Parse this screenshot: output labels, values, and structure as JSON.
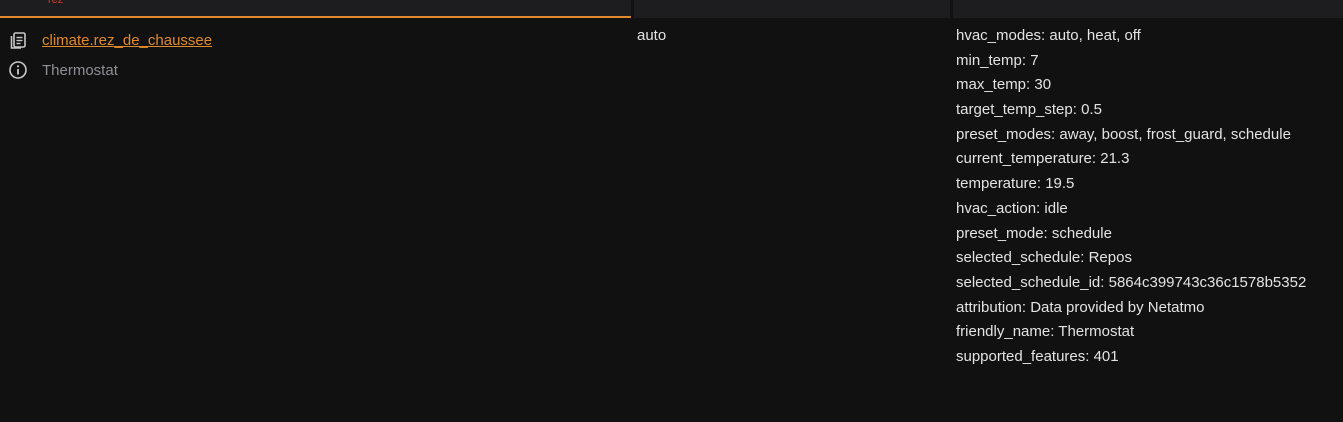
{
  "header": {
    "filter_text": "rez"
  },
  "entity": {
    "id": "climate.rez_de_chaussee",
    "friendly_name": "Thermostat",
    "state": "auto"
  },
  "attributes": [
    "hvac_modes: auto, heat, off",
    "min_temp: 7",
    "max_temp: 30",
    "target_temp_step: 0.5",
    "preset_modes: away, boost, frost_guard, schedule",
    "current_temperature: 21.3",
    "temperature: 19.5",
    "hvac_action: idle",
    "preset_mode: schedule",
    "selected_schedule: Repos",
    "selected_schedule_id: 5864c399743c36c1578b5352",
    "attribution: Data provided by Netatmo",
    "friendly_name: Thermostat",
    "supported_features: 401"
  ],
  "colors": {
    "accent": "#e08a2c",
    "background": "#111111",
    "header": "#1d1d1f",
    "text": "#e3e3e3",
    "muted": "#8f8f96"
  },
  "icons": {
    "copy": "clipboard-copy-icon",
    "info": "info-circle-icon"
  }
}
